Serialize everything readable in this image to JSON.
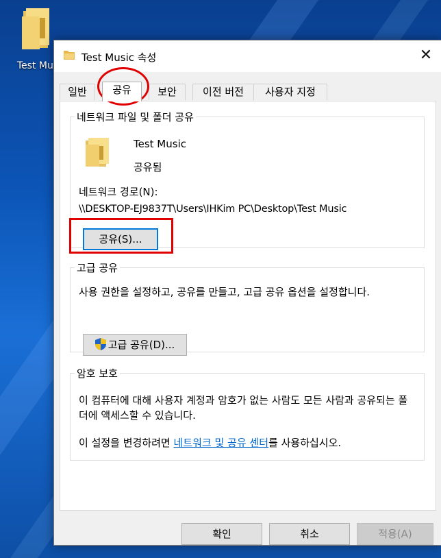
{
  "desktop": {
    "icon_label": "Test Mus"
  },
  "window": {
    "title": "Test Music 속성",
    "close_glyph": "✕"
  },
  "tabs": [
    {
      "label": "일반"
    },
    {
      "label": "공유"
    },
    {
      "label": "보안"
    },
    {
      "label": "이전 버전"
    },
    {
      "label": "사용자 지정"
    }
  ],
  "network_sharing": {
    "legend": "네트워크 파일 및 폴더 공유",
    "folder_name": "Test Music",
    "status": "공유됨",
    "path_label": "네트워크 경로(N):",
    "path": "\\\\DESKTOP-EJ9837T\\Users\\IHKim PC\\Desktop\\Test Music",
    "share_button": "공유(S)..."
  },
  "advanced_sharing": {
    "legend": "고급 공유",
    "description": "사용 권한을 설정하고, 공유를 만들고, 고급 공유 옵션을 설정합니다.",
    "button": "고급 공유(D)...",
    "button_icon": "uac-shield-icon"
  },
  "password_protection": {
    "legend": "암호 보호",
    "description": "이 컴퓨터에 대해 사용자 계정과 암호가 없는 사람도 모든 사람과 공유되는 폴더에 액세스할 수 있습니다.",
    "link_prefix": "이 설정을 변경하려면 ",
    "link_text": "네트워크 및 공유 센터",
    "link_suffix": "를 사용하십시오."
  },
  "footer": {
    "ok": "확인",
    "cancel": "취소",
    "apply": "적용(A)"
  },
  "colors": {
    "annotation": "#e00000",
    "link": "#0066cc",
    "accent": "#0078d7"
  }
}
